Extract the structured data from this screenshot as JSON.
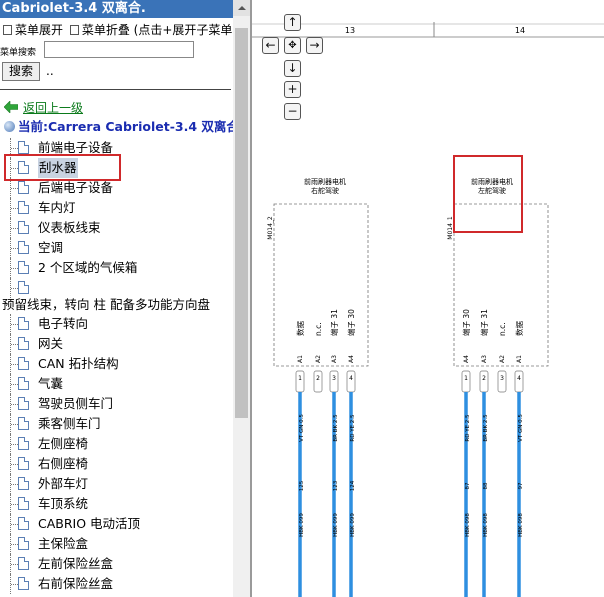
{
  "window": {
    "title": "Cabriolet-3.4 双离合."
  },
  "menu": {
    "expand_label": "菜单展开",
    "collapse_label": "菜单折叠 (点击+展开子菜单)"
  },
  "search": {
    "label": "菜单搜索",
    "value": "",
    "button_label": "搜索",
    "dots": ".."
  },
  "nav": {
    "back_label": "返回上一级",
    "current_label": "当前:Carrera Cabriolet-3.4 双离合"
  },
  "tree": {
    "items": [
      {
        "label": "前端电子设备"
      },
      {
        "label": "刮水器",
        "selected": true
      },
      {
        "label": "后端电子设备"
      },
      {
        "label": "车内灯"
      },
      {
        "label": "仪表板线束"
      },
      {
        "label": "空调"
      },
      {
        "label": "2 个区域的气候箱"
      },
      {
        "label": ""
      }
    ],
    "wrapped_item": "预留线束，转向 柱 配备多功能方向盘",
    "items2": [
      {
        "label": "电子转向"
      },
      {
        "label": "网关"
      },
      {
        "label": "CAN 拓扑结构"
      },
      {
        "label": "气囊"
      },
      {
        "label": "驾驶员侧车门"
      },
      {
        "label": "乘客侧车门"
      },
      {
        "label": "左侧座椅"
      },
      {
        "label": "右侧座椅"
      },
      {
        "label": "外部车灯"
      },
      {
        "label": "车顶系统"
      },
      {
        "label": "CABRIO 电动活顶"
      },
      {
        "label": "主保险盒"
      },
      {
        "label": "左前保险丝盒"
      },
      {
        "label": "右前保险丝盒"
      }
    ]
  },
  "diagram": {
    "nav_buttons": {
      "up": "↑",
      "left": "←",
      "center": "✥",
      "right": "→",
      "down": "↓",
      "zoom_in": "+",
      "zoom_out": "−"
    },
    "column_numbers": [
      "13",
      "14"
    ],
    "components": [
      {
        "title_line1": "前雨刷器电机",
        "title_line2": "右舵驾驶",
        "code": "M014_2",
        "pin_labels": [
          "数据",
          "n.c.",
          "端子 31",
          "端子 30"
        ],
        "pin_codes": [
          "A1",
          "A2",
          "A3",
          "A4"
        ],
        "connectors": [
          "1",
          "2",
          "3",
          "4"
        ],
        "wire_specs": [
          "VT GN 0.5",
          "",
          "BR BK 2.5",
          "RD YE 2.5"
        ],
        "wire_numbers": [
          "125",
          "",
          "123",
          "124"
        ],
        "harness_codes": [
          "HBK 099",
          "",
          "HBK 099",
          "HBK 099"
        ]
      },
      {
        "title_line1": "前雨刷器电机",
        "title_line2": "左舵驾驶",
        "code": "M014_1",
        "pin_labels": [
          "端子 30",
          "端子 31",
          "n.c.",
          "数据"
        ],
        "pin_codes": [
          "A4",
          "A3",
          "A2",
          "A1"
        ],
        "connectors": [
          "1",
          "2",
          "3",
          "4"
        ],
        "wire_specs": [
          "RD YE 2.5",
          "BR BK 2.5",
          "",
          "VT GN 0.5"
        ],
        "wire_numbers": [
          "87",
          "88",
          "",
          "97"
        ],
        "harness_codes": [
          "HBK 098",
          "HBK 098",
          "",
          "HBK 098"
        ]
      }
    ],
    "colors": {
      "wire": "#2e8fe0",
      "highlight": "#d0292b"
    }
  }
}
